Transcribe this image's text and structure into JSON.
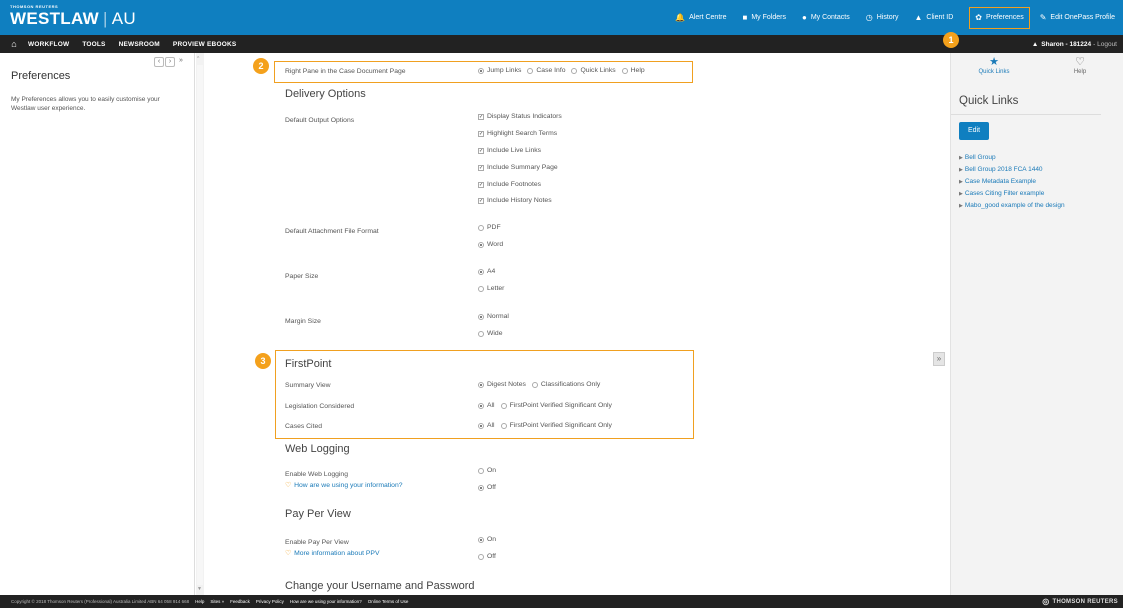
{
  "brand": {
    "sub": "THOMSON REUTERS",
    "main": "WESTLAW",
    "region": "AU"
  },
  "topnav": [
    {
      "icon": "bell-icon",
      "glyph": "🔔",
      "label": "Alert Centre"
    },
    {
      "icon": "folder-icon",
      "glyph": "■",
      "label": "My Folders"
    },
    {
      "icon": "contacts-icon",
      "glyph": "●",
      "label": "My Contacts"
    },
    {
      "icon": "history-icon",
      "glyph": "◷",
      "label": "History"
    },
    {
      "icon": "user-icon",
      "glyph": "▲",
      "label": "Client ID"
    },
    {
      "icon": "gear-icon",
      "glyph": "✿",
      "label": "Preferences"
    },
    {
      "icon": "edit-icon",
      "glyph": "✎",
      "label": "Edit OnePass Profile"
    }
  ],
  "navbar": {
    "home_glyph": "⌂",
    "items": [
      "WORKFLOW",
      "TOOLS",
      "NEWSROOM",
      "PROVIEW EBOOKS"
    ],
    "user": "Sharon - 181224",
    "logout": "- Logout"
  },
  "left": {
    "title": "Preferences",
    "description": "My Preferences allows you to easily customise your Westlaw user experience.",
    "controls": [
      "‹",
      "›",
      "»",
      "^"
    ]
  },
  "main": {
    "right_pane": {
      "label": "Right Pane in the Case Document Page",
      "options": [
        "Jump Links",
        "Case Info",
        "Quick Links",
        "Help"
      ],
      "selected": 0
    },
    "delivery": {
      "title": "Delivery Options",
      "output_label": "Default Output Options",
      "output_options": [
        "Display Status Indicators",
        "Highlight Search Terms",
        "Include Live Links",
        "Include Summary Page",
        "Include Footnotes",
        "Include History Notes"
      ],
      "attachment_label": "Default Attachment File Format",
      "attachment_options": [
        "PDF",
        "Word"
      ],
      "paper_label": "Paper Size",
      "paper_options": [
        "A4",
        "Letter"
      ],
      "margin_label": "Margin Size",
      "margin_options": [
        "Normal",
        "Wide"
      ]
    },
    "firstpoint": {
      "title": "FirstPoint",
      "summary_label": "Summary View",
      "summary_options": [
        "Digest Notes",
        "Classifications Only"
      ],
      "legislation_label": "Legislation Considered",
      "legislation_options": [
        "All",
        "FirstPoint Verified Significant Only"
      ],
      "cases_label": "Cases Cited",
      "cases_options": [
        "All",
        "FirstPoint Verified Significant Only"
      ]
    },
    "weblogging": {
      "title": "Web Logging",
      "label": "Enable Web Logging",
      "info_link": "How are we using your information?",
      "options": [
        "On",
        "Off"
      ]
    },
    "ppv": {
      "title": "Pay Per View",
      "label": "Enable Pay Per View",
      "info_link": "More information about PPV",
      "options": [
        "On",
        "Off"
      ]
    },
    "username": {
      "title": "Change your Username and Password"
    }
  },
  "badges": [
    "1",
    "2",
    "3"
  ],
  "midtoggle": "»",
  "right": {
    "tabs": [
      {
        "icon": "star-icon",
        "glyph": "★",
        "label": "Quick Links"
      },
      {
        "icon": "lightbulb-icon",
        "glyph": "♡",
        "label": "Help"
      }
    ],
    "title": "Quick Links",
    "edit_label": "Edit",
    "links": [
      "Bell Group",
      "Bell Group 2018 FCA 1440",
      "Case Metadata Example",
      "Cases Citing Filter example",
      "Mabo_good example of the design"
    ]
  },
  "footer": {
    "copyright": "Copyright © 2018 Thomson Reuters (Professional) Australia Limited ABN 64 058 914 668",
    "links": [
      "Help",
      "Sites »",
      "Feedback",
      "Privacy Policy",
      "How are we using your information?",
      "Online Terms of Use"
    ],
    "brand": "THOMSON REUTERS"
  },
  "colors": {
    "topbar": "#0f7fc0",
    "navbar": "#222222",
    "highlight": "#f0a020",
    "badge": "#f4a11c",
    "link": "#1a7ab8"
  }
}
